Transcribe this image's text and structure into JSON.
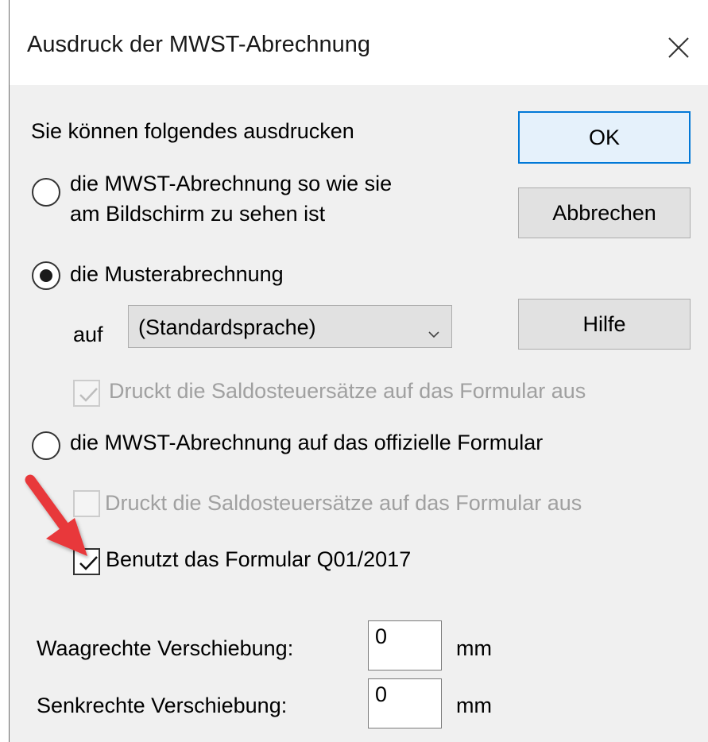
{
  "window": {
    "title": "Ausdruck der MWST-Abrechnung",
    "close_icon": "close-icon"
  },
  "intro": "Sie können folgendes ausdrucken",
  "options": {
    "screen": {
      "line1": "die MWST-Abrechnung so wie sie",
      "line2": "am Bildschirm zu sehen ist",
      "selected": false
    },
    "sample": {
      "label": "die Musterabrechnung",
      "selected": true,
      "language_prefix": "auf",
      "language_value": "(Standardsprache)",
      "print_rates_label": "Druckt die Saldosteuersätze auf das Formular aus",
      "print_rates_checked": true,
      "print_rates_enabled": false
    },
    "official": {
      "label": "die MWST-Abrechnung auf das offizielle Formular",
      "selected": false,
      "print_rates_label": "Druckt die Saldosteuersätze auf das Formular aus",
      "print_rates_checked": false,
      "print_rates_enabled": false,
      "use_form_label": "Benutzt das Formular Q01/2017",
      "use_form_checked": true
    }
  },
  "buttons": {
    "ok": "OK",
    "cancel": "Abbrechen",
    "help": "Hilfe"
  },
  "offsets": {
    "horizontal_label": "Waagrechte Verschiebung:",
    "horizontal_value": "0",
    "horizontal_unit": "mm",
    "vertical_label": "Senkrechte Verschiebung:",
    "vertical_value": "0",
    "vertical_unit": "mm"
  },
  "annotation": {
    "arrow_color": "#e8383b"
  }
}
